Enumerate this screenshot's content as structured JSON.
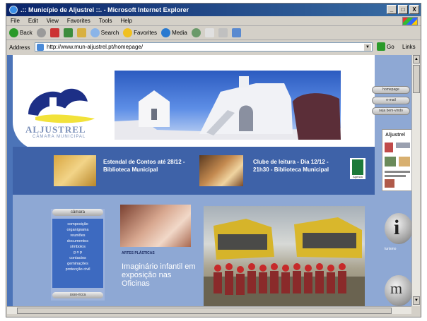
{
  "window": {
    "title": ".:: Município de Aljustrel ::. - Microsoft Internet Explorer",
    "controls": [
      "_",
      "□",
      "X"
    ]
  },
  "menubar": [
    "File",
    "Edit",
    "View",
    "Favorites",
    "Tools",
    "Help"
  ],
  "toolbar": {
    "back": "Back",
    "search": "Search",
    "favorites": "Favorites",
    "media": "Media"
  },
  "address": {
    "label": "Address",
    "url": "http://www.mun-aljustrel.pt/homepage/",
    "go": "Go",
    "links": "Links"
  },
  "site": {
    "logo_name": "ALJUSTREL",
    "logo_sub": "CÂMARA MUNICIPAL",
    "nav": [
      "homepage",
      "e-mail",
      "seja bem-vindo"
    ],
    "news": [
      "Estendal de Contos até 28/12 - Biblioteca Municipal",
      "Clube de leitura - Dia 12/12 - 21h30 - Biblioteca Municipal"
    ],
    "badge_label": "Agenda",
    "magazine_title": "Aljustrel",
    "menu_head": "câmara",
    "menu_items": [
      "composição",
      "organigrama",
      "reuniões",
      "documentos",
      "símbolos",
      "g o p",
      "contactos",
      "geminações",
      "protecção civil"
    ],
    "menu_foot": "ssso-ricca",
    "art_caption": "ARTES PLÁSTICAS",
    "art_text": "Imaginário infantil em exposição nas Oficinas",
    "info_label": "turismo",
    "info_glyph": "i",
    "m_glyph": "m"
  }
}
